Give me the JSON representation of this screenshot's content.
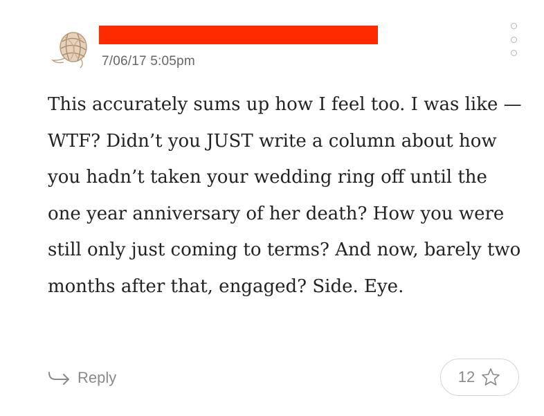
{
  "comment": {
    "timestamp": "7/06/17 5:05pm",
    "redaction_color": "#ff2a00",
    "body": "This accurately sums up how I feel too. I was like — WTF? Didn’t you JUST write a column about how you hadn’t taken your wedding ring off until the one year anniversary of her death? How you were still only just coming to terms? And now, barely two months after that, engaged? Side. Eye."
  },
  "actions": {
    "reply_label": "Reply",
    "reply_icon": "reply-arrow-icon",
    "star_count": "12",
    "star_icon": "star-outline-icon",
    "more_icon": "more-dots-vertical-icon"
  }
}
